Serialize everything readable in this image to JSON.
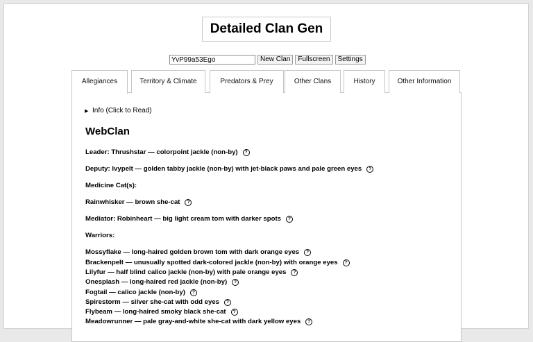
{
  "title": "Detailed Clan Gen",
  "controls": {
    "seed_value": "YvP99a53Ego",
    "new_clan": "New Clan",
    "fullscreen": "Fullscreen",
    "settings": "Settings"
  },
  "tabs": [
    {
      "label": "Allegiances",
      "active": true
    },
    {
      "label": "Territory & Climate"
    },
    {
      "label": "Predators & Prey"
    },
    {
      "label": "Other Clans"
    },
    {
      "label": "History"
    },
    {
      "label": "Other Information"
    }
  ],
  "info_toggle": "Info (Click to Read)",
  "info_arrow": "▶",
  "clan_name": "WebClan",
  "help_glyph": "?",
  "allegiances": {
    "leader": "Leader: Thrushstar — colorpoint jackle (non-by)",
    "deputy": "Deputy: Ivypelt — golden tabby jackle (non-by) with jet-black paws and pale green eyes",
    "medicine_header": "Medicine Cat(s):",
    "medicine_cat": "Rainwhisker — brown she-cat",
    "mediator": "Mediator: Robinheart — big light cream tom with darker spots",
    "warriors_header": "Warriors:",
    "warriors": [
      "Mossyflake — long-haired golden brown tom with dark orange eyes",
      "Brackenpelt — unusually spotted dark-colored jackle (non-by) with orange eyes",
      "Lilyfur — half blind calico jackle (non-by) with pale orange eyes",
      "Onesplash — long-haired red jackle (non-by)",
      "Fogtail — calico jackle (non-by)",
      "Spirestorm — silver she-cat with odd eyes",
      "Flybeam — long-haired smoky black she-cat",
      "Meadowrunner — pale gray-and-white she-cat with dark yellow eyes"
    ]
  }
}
